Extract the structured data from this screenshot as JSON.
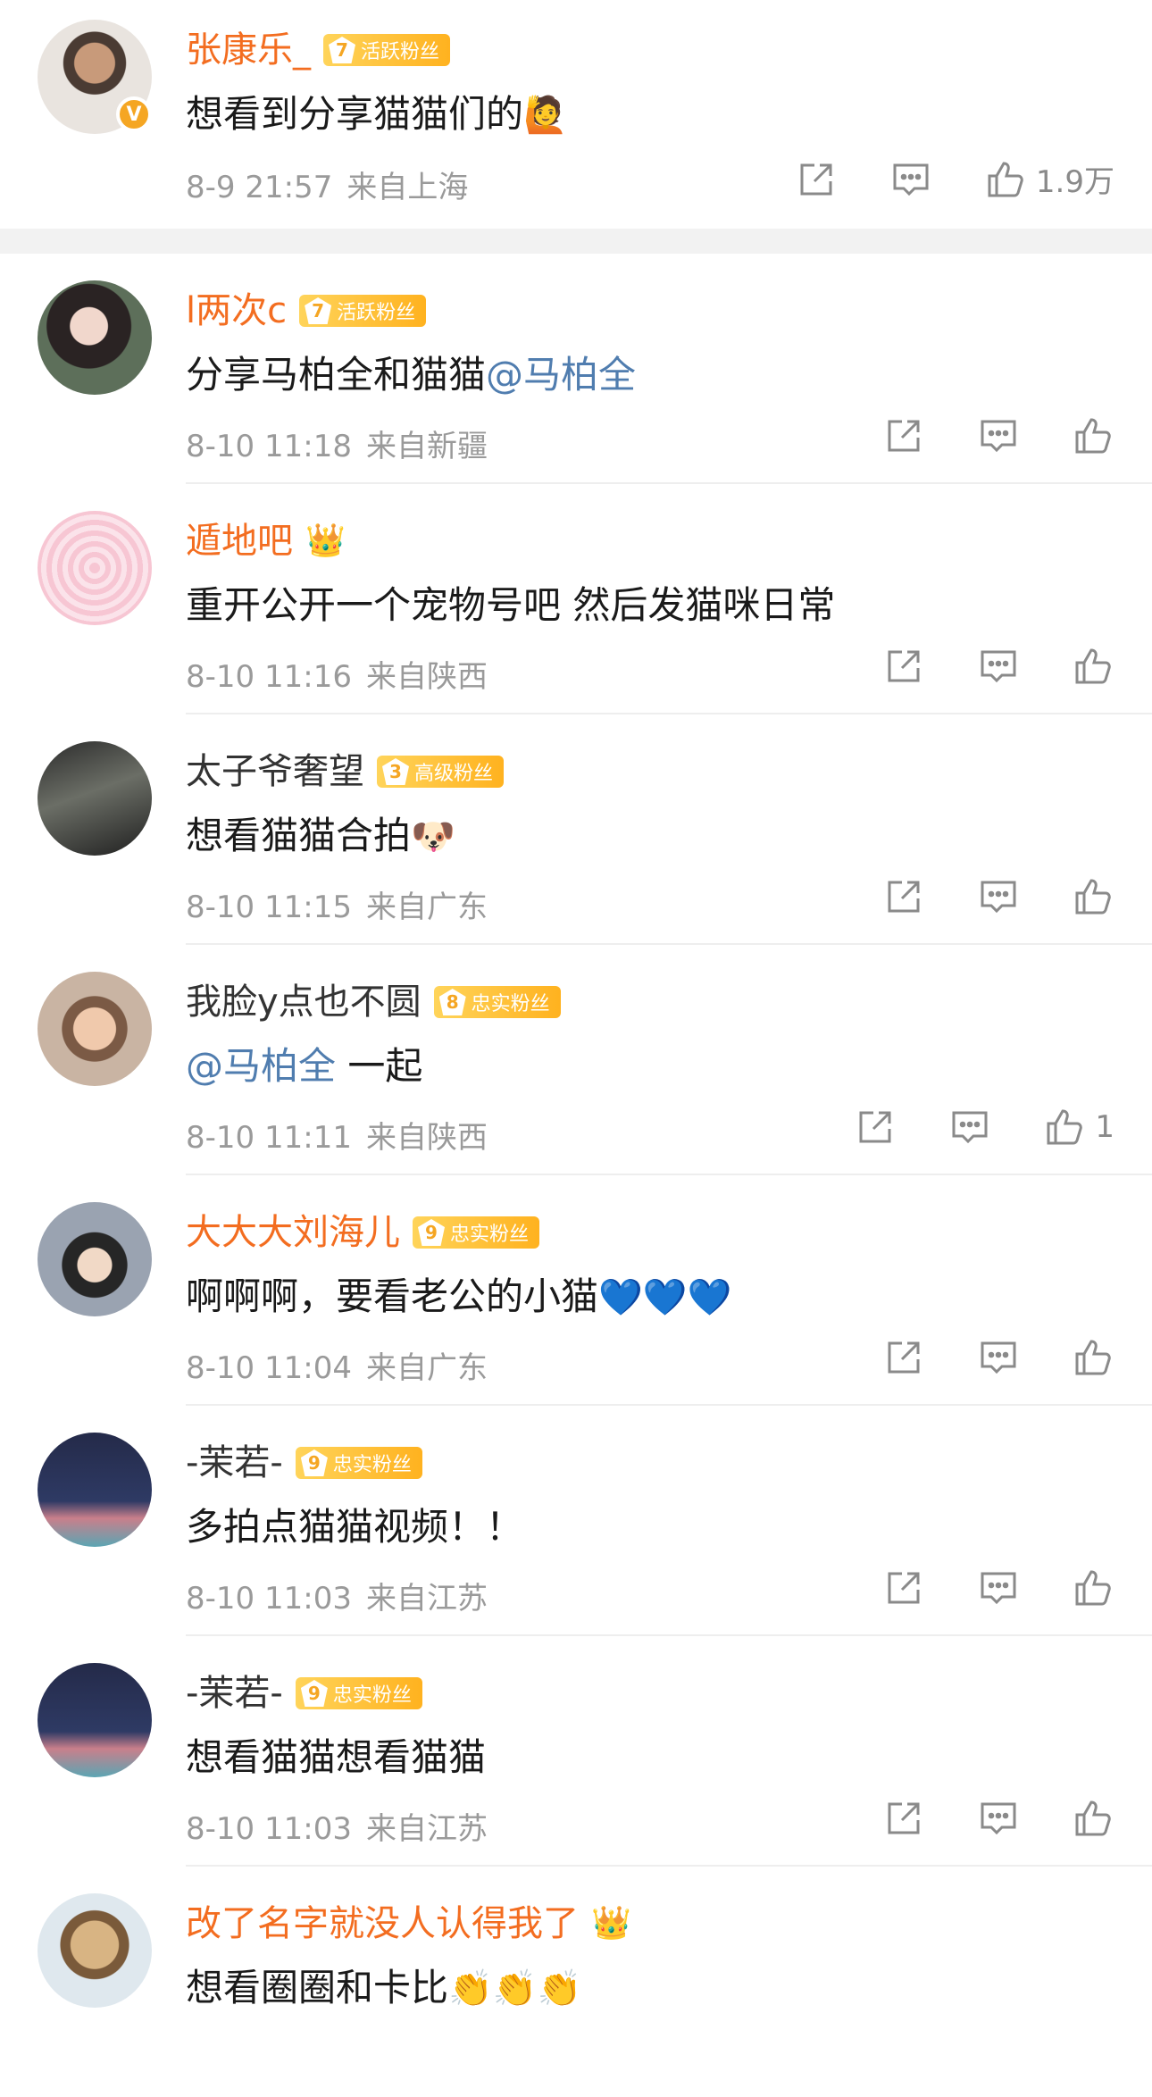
{
  "comments": [
    {
      "name": "张康乐_",
      "badge_level": "7",
      "badge_text": "活跃粉丝",
      "text": "想看到分享猫猫们的",
      "emoji": "🙋",
      "time": "8-9 21:57",
      "location": "来自上海",
      "likes": "1.9万"
    },
    {
      "name": "l两次c",
      "badge_level": "7",
      "badge_text": "活跃粉丝",
      "text": "分享马柏全和猫猫",
      "mention": "@马柏全",
      "time": "8-10 11:18",
      "location": "来自新疆"
    },
    {
      "name": "遁地吧",
      "crown": "👑",
      "text": "重开公开一个宠物号吧 然后发猫咪日常",
      "time": "8-10 11:16",
      "location": "来自陕西"
    },
    {
      "name": "太子爷奢望",
      "badge_level": "3",
      "badge_text": "高级粉丝",
      "text": "想看猫猫合拍",
      "emoji": "🐶",
      "time": "8-10 11:15",
      "location": "来自广东"
    },
    {
      "name": "我脸y点也不圆",
      "badge_level": "8",
      "badge_text": "忠实粉丝",
      "mention": "@马柏全",
      "text": " 一起",
      "time": "8-10 11:11",
      "location": "来自陕西",
      "likes": "1"
    },
    {
      "name": "大大大刘海儿",
      "badge_level": "9",
      "badge_text": "忠实粉丝",
      "text": "啊啊啊，要看老公的小猫",
      "emoji": "💙💙💙",
      "time": "8-10 11:04",
      "location": "来自广东"
    },
    {
      "name": "-茉若-",
      "badge_level": "9",
      "badge_text": "忠实粉丝",
      "text": "多拍点猫猫视频！！",
      "time": "8-10 11:03",
      "location": "来自江苏"
    },
    {
      "name": "-茉若-",
      "badge_level": "9",
      "badge_text": "忠实粉丝",
      "text": "想看猫猫想看猫猫",
      "time": "8-10 11:03",
      "location": "来自江苏"
    },
    {
      "name": "改了名字就没人认得我了",
      "crown": "👑",
      "text": "想看圈圈和卡比",
      "emoji": "👏👏👏"
    }
  ],
  "verified_mark": "V",
  "colors": {
    "name_orange": "#f36d20",
    "mention_blue": "#507daf",
    "meta_gray": "#9a9a9a",
    "badge_gold": "#ffb21f"
  },
  "icons": {
    "share": "share-icon",
    "comment": "comment-icon",
    "like": "like-icon"
  }
}
